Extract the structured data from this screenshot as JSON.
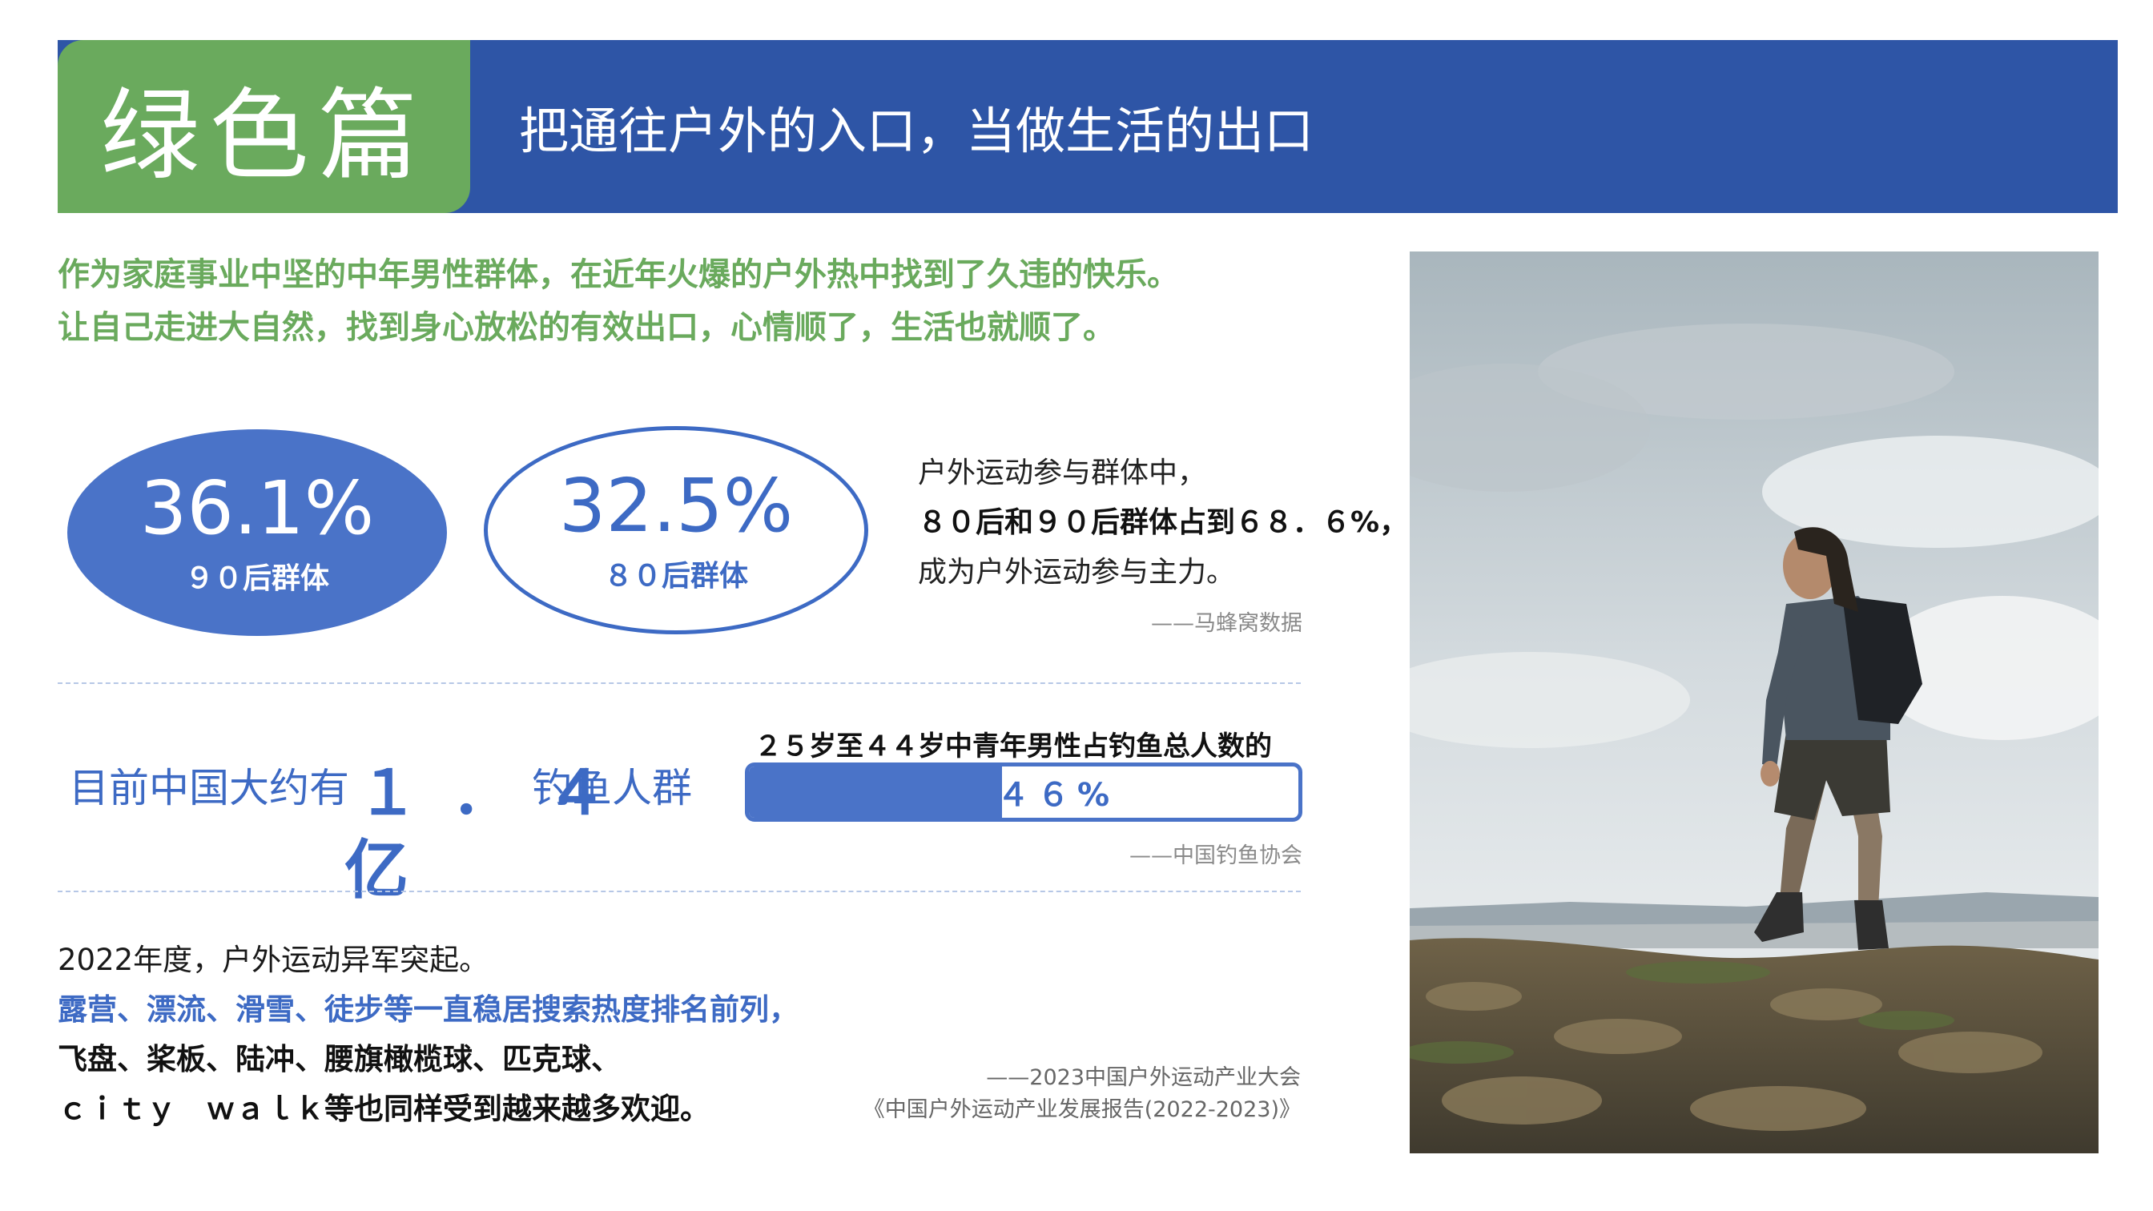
{
  "header": {
    "section_title": "绿色篇",
    "subtitle": "把通往户外的入口，当做生活的出口"
  },
  "intro": {
    "line1": "作为家庭事业中坚的中年男性群体，在近年火爆的户外热中找到了久违的快乐。",
    "line2": "让自己走进大自然，找到身心放松的有效出口，心情顺了，生活也就顺了。"
  },
  "stats": [
    {
      "value": "36.1%",
      "label": "９０后群体"
    },
    {
      "value": "32.5%",
      "label": "８０后群体"
    }
  ],
  "age_note": {
    "line1": "户外运动参与群体中，",
    "line2": "８０后和９０后群体占到６８．６%，",
    "line3": "成为户外运动参与主力。",
    "source": "——马蜂窝数据"
  },
  "fishing": {
    "prefix": "目前中国大约有",
    "number": "１．４",
    "unit": "亿",
    "suffix": "钓鱼人群",
    "caption": "２５岁至４４岁中青年男性占钓鱼总人数的",
    "percent_text": "４６%",
    "percent_value": 0.46,
    "source": "——中国钓鱼协会"
  },
  "outdoor_2022": {
    "line1": "2022年度，户外运动异军突起。",
    "line2": "露营、漂流、滑雪、徒步等一直稳居搜索热度排名前列，",
    "line3": "飞盘、桨板、陆冲、腰旗橄榄球、匹克球、",
    "line4": "ｃｉｔｙ　ｗａｌｋ等也同样受到越来越多欢迎。",
    "source_line1": "——2023中国户外运动产业大会",
    "source_line2": "《中国户外运动产业发展报告(2022-2023)》"
  },
  "colors": {
    "header_blue": "#2e55a6",
    "tab_green": "#6aaa5d",
    "accent_blue": "#4a73c8"
  }
}
